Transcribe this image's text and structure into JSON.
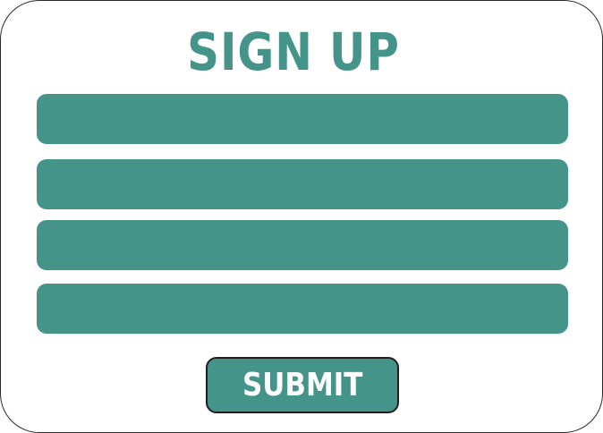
{
  "form": {
    "title": "SIGN UP",
    "fields": [
      {
        "value": "",
        "placeholder": ""
      },
      {
        "value": "",
        "placeholder": ""
      },
      {
        "value": "",
        "placeholder": ""
      },
      {
        "value": "",
        "placeholder": ""
      }
    ],
    "submit_label": "SUBMIT"
  },
  "colors": {
    "accent": "#45948a",
    "border": "#1e1e1e",
    "background": "#ffffff"
  }
}
